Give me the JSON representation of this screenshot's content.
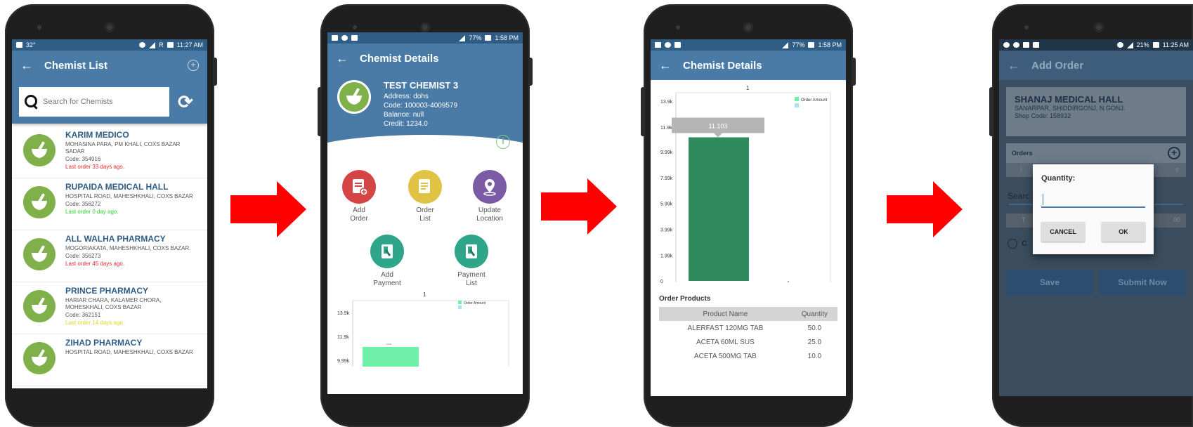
{
  "screen1": {
    "status": {
      "temp": "32°",
      "time": "11:27 AM",
      "net": "R"
    },
    "title": "Chemist List",
    "back": "←",
    "add": "+",
    "search_placeholder": "Search for Chemists",
    "refresh_icon": "⟳",
    "chemists": [
      {
        "name": "KARIM MEDICO",
        "address": "MOHASINA PARA, PM KHALI, COXS BAZAR SADAR",
        "code": "Code: 354916",
        "last": "Last order 33 days ago.",
        "last_color": "#e02a2a"
      },
      {
        "name": "RUPAIDA MEDICAL HALL",
        "address": "HOSPITAL ROAD, MAHESHKHALI, COXS BAZAR",
        "code": "Code: 356272",
        "last": "Last order 0 day ago.",
        "last_color": "#2fcf2f"
      },
      {
        "name": "ALL WALHA PHARMACY",
        "address": "MOGORIAKATA, MAHESHKHALI, COXS BAZAR.",
        "code": "Code: 356273",
        "last": "Last order 45 days ago.",
        "last_color": "#e02a2a"
      },
      {
        "name": "PRINCE PHARMACY",
        "address": "HARIAR CHARA, KALAMER CHORA, MOHESKHALI, COXS BAZAR",
        "code": "Code: 362151",
        "last": "Last order 14 days ago.",
        "last_color": "#f0e020"
      },
      {
        "name": "ZIHAD PHARMACY",
        "address": "HOSPITAL ROAD, MAHESHKHALI, COXS BAZAR",
        "code": "",
        "last": "",
        "last_color": "#e02a2a"
      }
    ]
  },
  "screen2": {
    "status": {
      "battery": "77%",
      "time": "1:58 PM"
    },
    "title": "Chemist Details",
    "back": "←",
    "name": "TEST CHEMIST 3",
    "address": "Address: dohs",
    "code": "Code: 100003-4009579",
    "balance": "Balance: null",
    "credit": "Credit: 1234.0",
    "info_icon": "i",
    "actions": [
      {
        "label1": "Add",
        "label2": "Order",
        "color": "#d64545"
      },
      {
        "label1": "Order",
        "label2": "List",
        "color": "#e0c244"
      },
      {
        "label1": "Update",
        "label2": "Location",
        "color": "#7b5aa6"
      },
      {
        "label1": "Add",
        "label2": "Payment",
        "color": "#2fa68a"
      },
      {
        "label1": "Payment",
        "label2": "List",
        "color": "#2fa68a"
      }
    ],
    "mini_chart": {
      "title": "1",
      "legend": "Order Amount",
      "ticks": [
        "13.9k",
        "11.9k",
        "9.99k"
      ],
      "bar_color": "#6ef0a8",
      "bar_label": "11.1k"
    }
  },
  "screen3": {
    "status": {
      "battery": "77%",
      "time": "1:58 PM"
    },
    "title": "Chemist Details",
    "back": "←",
    "chart_title": "1",
    "legend": "Order Amount",
    "tooltip": "11.103",
    "ticks": [
      "13.9k",
      "11.9k",
      "9.99k",
      "7.99k",
      "5.99k",
      "3.99k",
      "1.99k",
      "0"
    ],
    "order_products_title": "Order Products",
    "table_headers": [
      "Product Name",
      "Quantity"
    ],
    "rows": [
      [
        "ALERFAST 120MG TAB",
        "50.0"
      ],
      [
        "ACETA 60ML SUS",
        "25.0"
      ],
      [
        "ACETA  500MG TAB",
        "10.0"
      ]
    ]
  },
  "screen4": {
    "status": {
      "battery": "21%",
      "time": "11:25 AM"
    },
    "title": "Add Order",
    "back": "←",
    "shop_name": "SHANAJ MEDICAL HALL",
    "shop_address": "SANARPAR, SHIDDIRGONJ, N.GONJ.",
    "shop_code": "Shop Code: 158932",
    "orders_label": "Orders",
    "orders_add": "+",
    "search_partial": "Searc",
    "row_t": "T",
    "row_00": "00",
    "row_e": "e",
    "row_i": "I",
    "radio_partial": "C",
    "save": "Save",
    "submit": "Submit Now",
    "dialog": {
      "title": "Quantity:",
      "cancel": "CANCEL",
      "ok": "OK"
    }
  },
  "chart_data": {
    "type": "bar",
    "title": "1",
    "categories": [
      ""
    ],
    "series": [
      {
        "name": "Order Amount",
        "values": [
          11103
        ]
      }
    ],
    "ylim": [
      0,
      13900
    ],
    "yticks": [
      "0",
      "1.99k",
      "3.99k",
      "5.99k",
      "7.99k",
      "9.99k",
      "11.9k",
      "13.9k"
    ],
    "legend": "top-right",
    "colors": {
      "bar": "#2f8a5e",
      "legend": "#6ef0a8"
    }
  }
}
